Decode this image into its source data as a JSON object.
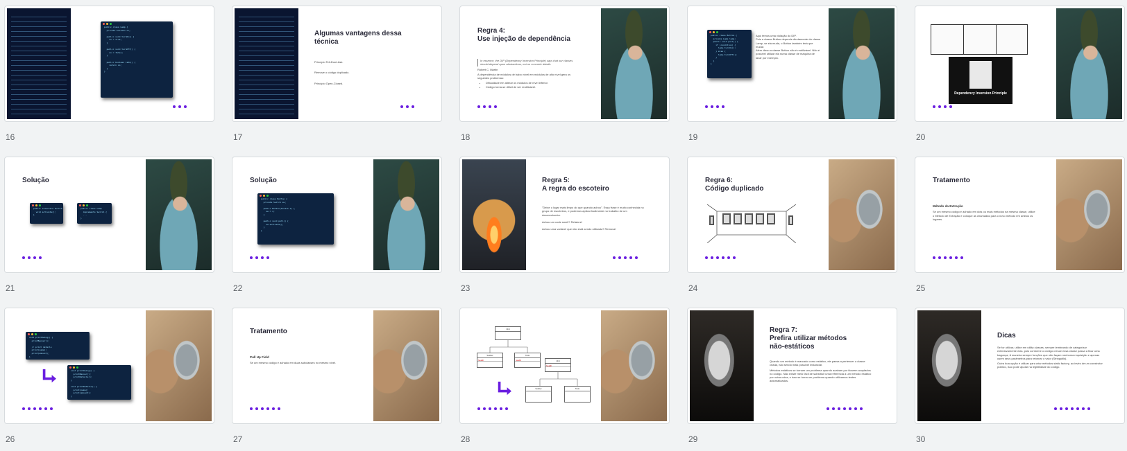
{
  "slides": [
    {
      "num": "16",
      "dots": 3
    },
    {
      "num": "17",
      "dots": 3,
      "title": "Algumas vantagens dessa técnica",
      "lines": [
        "Princípio Tell-Dont-Ask.",
        "Remove o código duplicado.",
        "Princípio Open-Closed."
      ]
    },
    {
      "num": "18",
      "dots": 4,
      "title1": "Regra 4:",
      "title2": "Use injeção de dependência",
      "quote": "In essence, the DIP (Dependency Inversion Principle) says that our classes should depend upon abstractions, not on concrete details.",
      "author": "Robert C. Martin",
      "text": "A dependência de módulos de baixo nível em módulos de alto nível gera os seguintes problemas:",
      "bullets": [
        "Dificuldade em alterar os módulos de nível inferior.",
        "Código torna-se difícil de ser reutilizável."
      ]
    },
    {
      "num": "19",
      "dots": 4,
      "lines": [
        "Aqui temos uma violação do DIP.",
        "Pois a classe Button depende diretamente da classe Lamp, se ela muda, o Button também terá que mudar.",
        "Além disso a classe Button não é reutilizável. Não é possível utilizar ela numa classe de máquina de lavar por exemplo."
      ]
    },
    {
      "num": "20",
      "dots": 4,
      "diagram_label": "Dependency Inversion Principle"
    },
    {
      "num": "21",
      "dots": 4,
      "title": "Solução"
    },
    {
      "num": "22",
      "dots": 4,
      "title": "Solução"
    },
    {
      "num": "23",
      "dots": 5,
      "title1": "Regra 5:",
      "title2": "A regra do escoteiro",
      "lines": [
        "\"Deixe o lugar mais limpo do que quando achou\". Essa frase é muito conhecida no grupo de escoteiros, e podemos aplicar facilmente no trabalho de um desenvolvedor.",
        "Achou um code smell? Refatore!",
        "Achou uma variável que não está sendo utilizada? Remova!"
      ]
    },
    {
      "num": "24",
      "dots": 6,
      "title1": "Regra 6:",
      "title2": "Código duplicado"
    },
    {
      "num": "25",
      "dots": 6,
      "title": "Tratamento",
      "subtitle": "Método da Extração",
      "text": "Se um mesmo código é achado em dois ou mais métodos na mesma classe, utilize o Método de Extração e coloque as chamadas para o novo método em ambos os lugares."
    },
    {
      "num": "26",
      "dots": 6
    },
    {
      "num": "27",
      "dots": 6,
      "title": "Tratamento",
      "subtitle": "Pull Up Field",
      "text": "Se um mesmo código é achado em duas subclasses no mesmo nível."
    },
    {
      "num": "28",
      "dots": 6,
      "uml": {
        "top": "Unit",
        "left": "Soldier",
        "right": "Tank",
        "b_top": "Unit",
        "b_left": "Soldier",
        "b_right": "Tank",
        "field": "health"
      }
    },
    {
      "num": "29",
      "dots": 7,
      "title1": "Regra 7:",
      "title2": "Prefira utilizar métodos",
      "title3": "não-estáticos",
      "lines": [
        "Quando um método é marcado como estático, ele passa a pertencer a classe criada, não sendo mais possível instanciar.",
        "Métodos estáticos se tornam um problema quando acabam por ficarem acoplados no código. Não existe meio fácil de substituir uma referência a um método estático por outra coisa, e isso se torna um problema quando utilizamos testes automatizados."
      ]
    },
    {
      "num": "30",
      "dots": 7,
      "title": "Dicas",
      "lines": [
        "Se for utilizar, utilize em utility classes, sempre lembrando de categorizar extensivamente elas, pois conforme o código cresce essa classe passa a ficar uma bagunça, ã maneira sempre funções que não façam nenhuma requisição e apenas usem seus parâmetros para retornar o valor (Stringutils).",
        "Outra boa opção é utilizar para criar métodos static factory, ao invés de um construtor público, isso pode ajudar na legibilidade do código."
      ]
    }
  ],
  "code": {
    "s16": "public class Lamp {\n  private boolean on;\n\n  public void turnOn() {\n    on = true;\n  }\n\n  public void turnOff() {\n    on = false;\n  }\n\n  public boolean isOn() {\n    return on;\n  }\n}",
    "s19": "public class Button {\n  private Lamp lamp;\n  public void poll() {\n    if (condition) {\n      lamp.turnOn();\n    } else {\n      lamp.turnOff();\n    }\n  }\n}",
    "s21a": "public interface Switch {\n  void activate();\n}",
    "s21b": "public class Lamp\n  implements Switch {\n  ...\n}",
    "s22": "public class Button {\n  private Switch sw;\n\n  public Button(Switch s) {\n    sw = s;\n  }\n\n  public void poll() {\n    sw.activate();\n  }\n}",
    "s26a": "void printOwing() {\n  printBanner();\n\n  // print details\n  print(name);\n  print(amount);\n}",
    "s26b": "void printOwing() {\n  printBanner();\n  printDetails();\n}\n\nvoid printDetails() {\n  print(name);\n  print(amount);\n}"
  }
}
